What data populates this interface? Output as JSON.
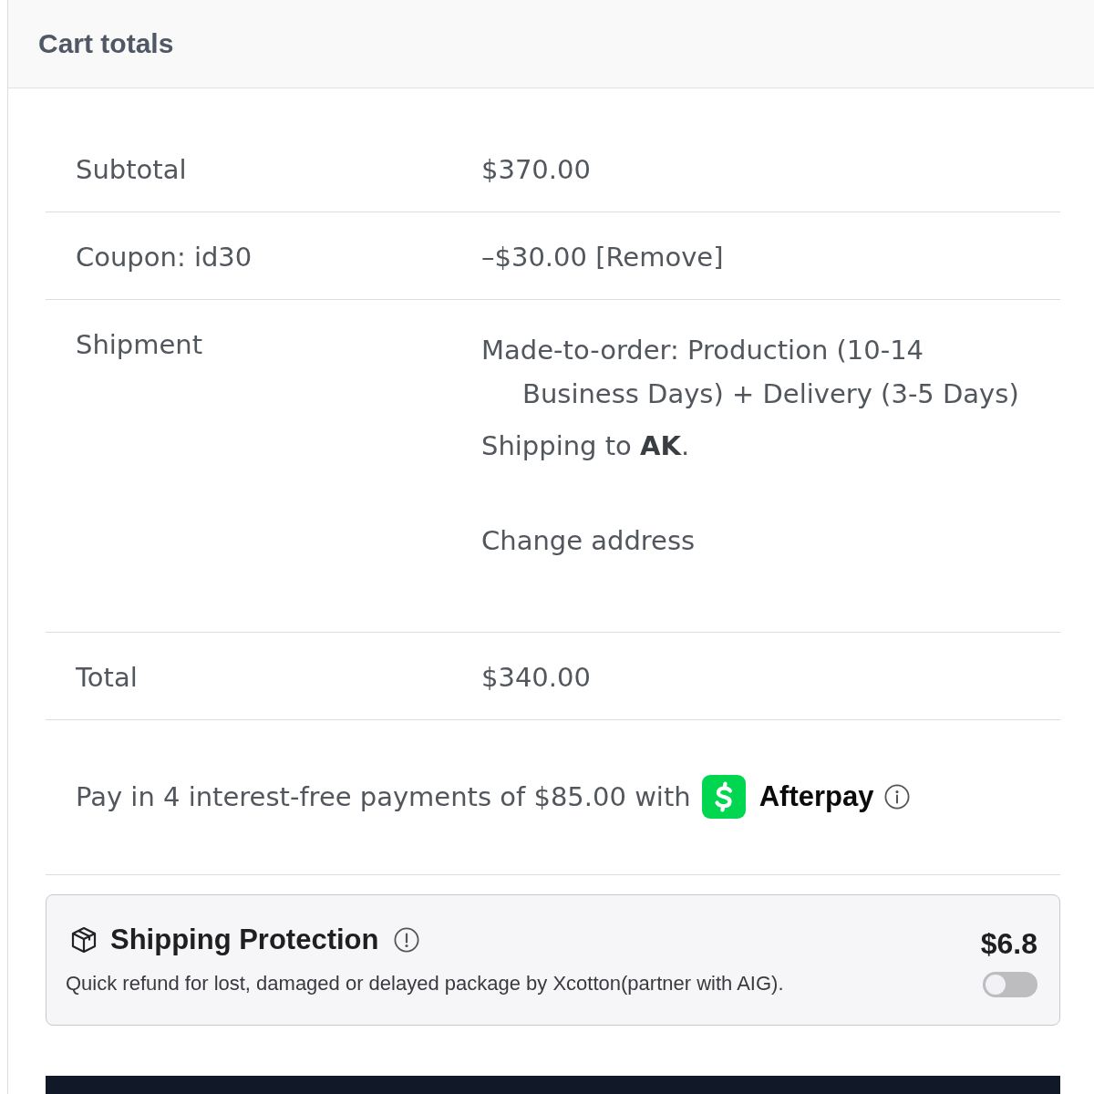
{
  "panel": {
    "title": "Cart totals"
  },
  "rows": [
    {
      "kind": "amount",
      "label": "Subtotal",
      "value": "$370.00"
    },
    {
      "kind": "coupon",
      "label": "Coupon: id30",
      "value": "–$30.00",
      "link": "[Remove]"
    },
    {
      "kind": "shipment",
      "label": "Shipment",
      "method": "Made-to-order: Production (10-14 Business Days) + Delivery (3-5 Days)",
      "destination": "Shipping to **AK**.",
      "link": "Change address"
    },
    {
      "kind": "amount",
      "label": "Total",
      "value": "$340.00"
    }
  ],
  "afterpay": {
    "text": "Pay in 4 interest-free payments of $85.00 with",
    "brand": "Afterpay"
  },
  "shipping_protection": {
    "title": "Shipping Protection",
    "description": "Quick refund for lost, damaged or delayed package by Xcotton(partner with AIG).",
    "price": "$6.8",
    "on": false
  }
}
